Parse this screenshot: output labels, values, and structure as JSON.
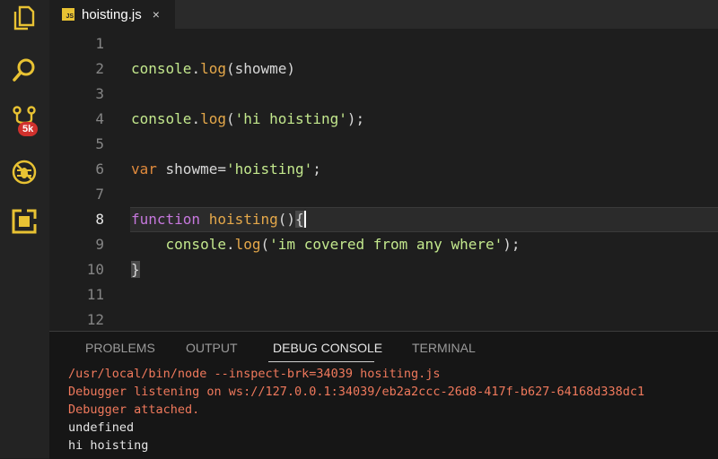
{
  "activity_bar": {
    "items": [
      {
        "name": "explorer-icon"
      },
      {
        "name": "search-icon"
      },
      {
        "name": "source-control-icon",
        "badge": "5k"
      },
      {
        "name": "debug-icon"
      },
      {
        "name": "extensions-icon"
      }
    ],
    "accent": "#e8c233"
  },
  "tab": {
    "badge": "JS",
    "title": "hoisting.js",
    "close": "×"
  },
  "editor": {
    "lines": [
      {
        "num": "1"
      },
      {
        "num": "2",
        "t": [
          {
            "c": "id",
            "v": "console"
          },
          {
            "c": "plain",
            "v": "."
          },
          {
            "c": "fn",
            "v": "log"
          },
          {
            "c": "plain",
            "v": "(showme)"
          }
        ]
      },
      {
        "num": "3"
      },
      {
        "num": "4",
        "t": [
          {
            "c": "id",
            "v": "console"
          },
          {
            "c": "plain",
            "v": "."
          },
          {
            "c": "fn",
            "v": "log"
          },
          {
            "c": "plain",
            "v": "("
          },
          {
            "c": "str",
            "v": "'hi hoisting'"
          },
          {
            "c": "plain",
            "v": ");"
          }
        ]
      },
      {
        "num": "5"
      },
      {
        "num": "6",
        "t": [
          {
            "c": "kw",
            "v": "var"
          },
          {
            "c": "plain",
            "v": " showme="
          },
          {
            "c": "str",
            "v": "'hoisting'"
          },
          {
            "c": "plain",
            "v": ";"
          }
        ]
      },
      {
        "num": "7"
      },
      {
        "num": "8",
        "t": [
          {
            "c": "kw2",
            "v": "function"
          },
          {
            "c": "plain",
            "v": " "
          },
          {
            "c": "fn",
            "v": "hoisting"
          },
          {
            "c": "plain",
            "v": "()"
          },
          {
            "c": "brace-hl",
            "v": "{"
          }
        ]
      },
      {
        "num": "9",
        "t": [
          {
            "c": "plain",
            "v": "    "
          },
          {
            "c": "id",
            "v": "console"
          },
          {
            "c": "plain",
            "v": "."
          },
          {
            "c": "fn",
            "v": "log"
          },
          {
            "c": "plain",
            "v": "("
          },
          {
            "c": "str",
            "v": "'im covered from any where'"
          },
          {
            "c": "plain",
            "v": ");"
          }
        ]
      },
      {
        "num": "10",
        "t": [
          {
            "c": "brace-hl",
            "v": "}"
          }
        ]
      },
      {
        "num": "11"
      },
      {
        "num": "12"
      }
    ],
    "active_line": "8"
  },
  "panel": {
    "tabs": [
      "PROBLEMS",
      "OUTPUT",
      "DEBUG CONSOLE",
      "TERMINAL"
    ],
    "active_tab": "DEBUG CONSOLE",
    "output": [
      {
        "kind": "err",
        "text": "/usr/local/bin/node --inspect-brk=34039 hositing.js"
      },
      {
        "kind": "err",
        "text": "Debugger listening on ws://127.0.0.1:34039/eb2a2ccc-26d8-417f-b627-64168d338dc1"
      },
      {
        "kind": "err",
        "text": "Debugger attached."
      },
      {
        "kind": "norm",
        "text": "undefined"
      },
      {
        "kind": "norm",
        "text": "hi hoisting"
      }
    ]
  }
}
